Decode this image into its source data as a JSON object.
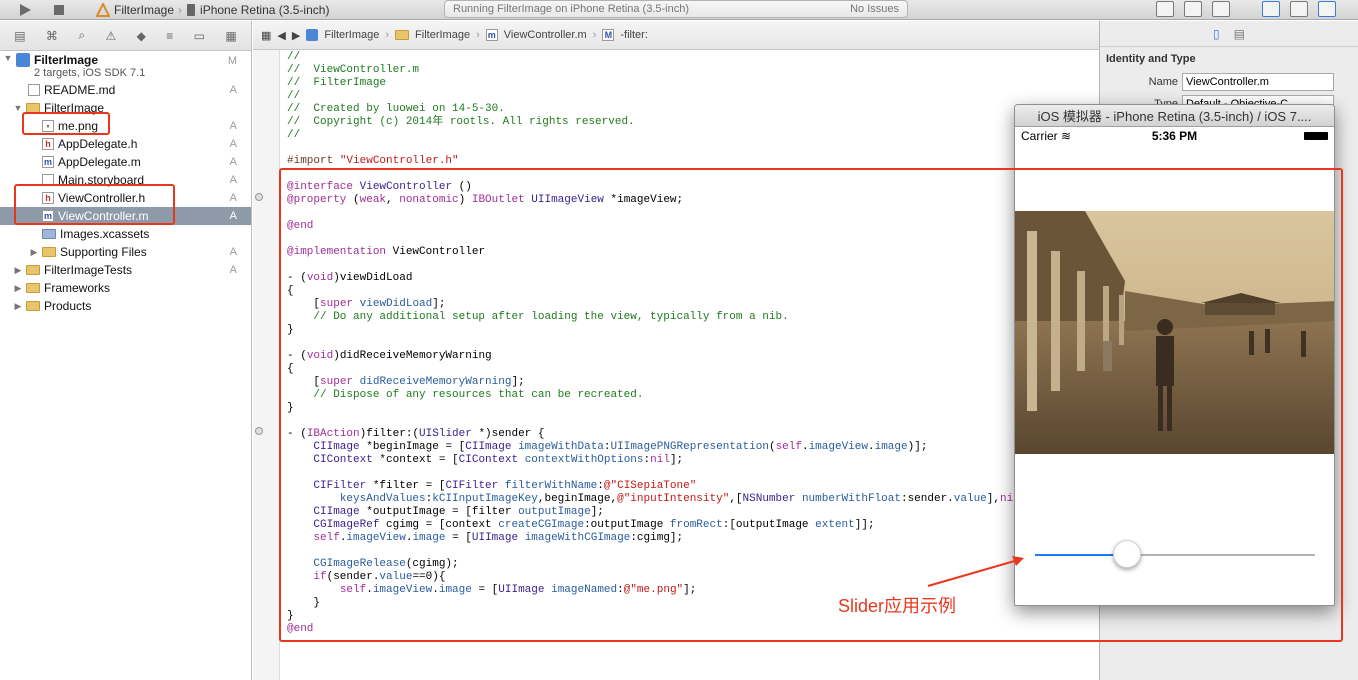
{
  "toolbar": {
    "scheme_target": "FilterImage",
    "scheme_device": "iPhone Retina (3.5-inch)",
    "status_text": "Running FilterImage on iPhone Retina (3.5-inch)",
    "issues_text": "No Issues"
  },
  "navigator": {
    "project_name": "FilterImage",
    "project_sub": "2 targets, iOS SDK 7.1",
    "project_badge": "M",
    "items": [
      {
        "label": "README.md",
        "badge": "A"
      },
      {
        "label": "FilterImage",
        "badge": ""
      },
      {
        "label": "me.png",
        "badge": "A"
      },
      {
        "label": "AppDelegate.h",
        "badge": "A"
      },
      {
        "label": "AppDelegate.m",
        "badge": "A"
      },
      {
        "label": "Main.storyboard",
        "badge": "A"
      },
      {
        "label": "ViewController.h",
        "badge": "A"
      },
      {
        "label": "ViewController.m",
        "badge": "A"
      },
      {
        "label": "Images.xcassets",
        "badge": "A"
      },
      {
        "label": "Supporting Files",
        "badge": "A"
      },
      {
        "label": "FilterImageTests",
        "badge": "A"
      },
      {
        "label": "Frameworks",
        "badge": ""
      },
      {
        "label": "Products",
        "badge": ""
      }
    ]
  },
  "jumpbar": [
    "FilterImage",
    "FilterImage",
    "ViewController.m",
    "-filter:"
  ],
  "inspector": {
    "section_title": "Identity and Type",
    "name_label": "Name",
    "name_value": "ViewController.m",
    "type_label": "Type",
    "type_value": "Default - Objective-C"
  },
  "simulator": {
    "title": "iOS 模拟器 - iPhone Retina (3.5-inch) / iOS 7....",
    "carrier": "Carrier",
    "time": "5:36 PM",
    "slider_value": 0.33
  },
  "annotation": "Slider应用示例"
}
